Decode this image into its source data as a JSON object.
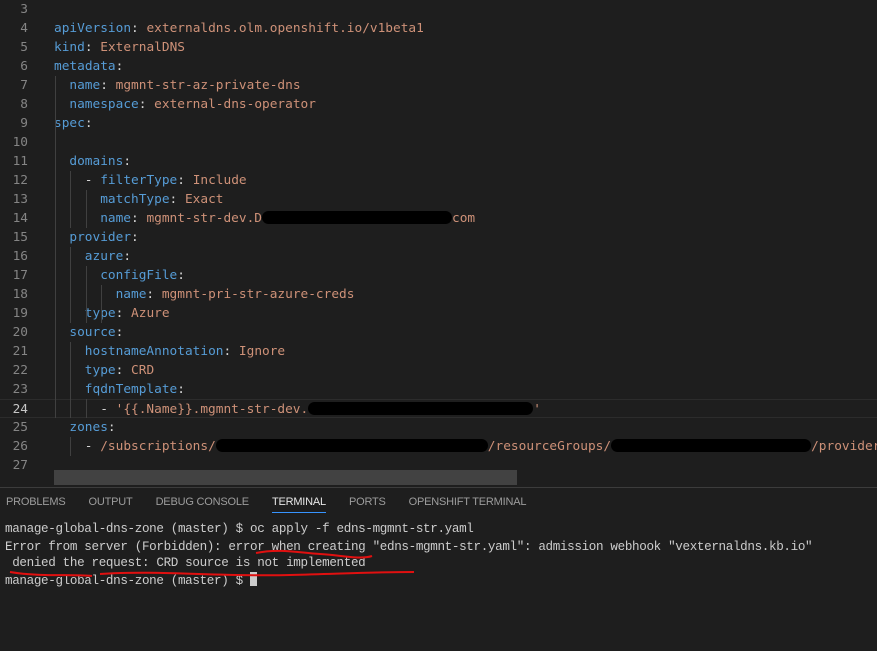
{
  "editor": {
    "current_line": 24,
    "lines": [
      {
        "num": "3",
        "indent": 0,
        "parts": []
      },
      {
        "num": "4",
        "indent": 0,
        "parts": [
          [
            "k",
            "apiVersion"
          ],
          [
            "p",
            ": "
          ],
          [
            "v",
            "externaldns.olm.openshift.io/v1beta1"
          ]
        ]
      },
      {
        "num": "5",
        "indent": 0,
        "parts": [
          [
            "k",
            "kind"
          ],
          [
            "p",
            ": "
          ],
          [
            "v",
            "ExternalDNS"
          ]
        ]
      },
      {
        "num": "6",
        "indent": 0,
        "parts": [
          [
            "k",
            "metadata"
          ],
          [
            "p",
            ":"
          ]
        ]
      },
      {
        "num": "7",
        "indent": 1,
        "parts": [
          [
            "k",
            "name"
          ],
          [
            "p",
            ": "
          ],
          [
            "v",
            "mgmnt-str-az-private-dns"
          ]
        ]
      },
      {
        "num": "8",
        "indent": 1,
        "parts": [
          [
            "k",
            "namespace"
          ],
          [
            "p",
            ": "
          ],
          [
            "v",
            "external-dns-operator"
          ]
        ]
      },
      {
        "num": "9",
        "indent": 0,
        "parts": [
          [
            "k",
            "spec"
          ],
          [
            "p",
            ":"
          ]
        ]
      },
      {
        "num": "10",
        "indent": 0,
        "parts": []
      },
      {
        "num": "11",
        "indent": 1,
        "parts": [
          [
            "k",
            "domains"
          ],
          [
            "p",
            ":"
          ]
        ]
      },
      {
        "num": "12",
        "indent": 2,
        "parts": [
          [
            "p",
            "- "
          ],
          [
            "k",
            "filterType"
          ],
          [
            "p",
            ": "
          ],
          [
            "v",
            "Include"
          ]
        ]
      },
      {
        "num": "13",
        "indent": 3,
        "parts": [
          [
            "k",
            "matchType"
          ],
          [
            "p",
            ": "
          ],
          [
            "v",
            "Exact"
          ]
        ]
      },
      {
        "num": "14",
        "indent": 3,
        "parts": [
          [
            "k",
            "name"
          ],
          [
            "p",
            ": "
          ],
          [
            "v",
            "mgmnt-str-dev.D"
          ],
          [
            "blob",
            "190"
          ],
          [
            "v",
            "com"
          ]
        ]
      },
      {
        "num": "15",
        "indent": 1,
        "parts": [
          [
            "k",
            "provider"
          ],
          [
            "p",
            ":"
          ]
        ]
      },
      {
        "num": "16",
        "indent": 2,
        "parts": [
          [
            "k",
            "azure"
          ],
          [
            "p",
            ":"
          ]
        ]
      },
      {
        "num": "17",
        "indent": 3,
        "parts": [
          [
            "k",
            "configFile"
          ],
          [
            "p",
            ":"
          ]
        ]
      },
      {
        "num": "18",
        "indent": 4,
        "parts": [
          [
            "k",
            "name"
          ],
          [
            "p",
            ": "
          ],
          [
            "v",
            "mgmnt-pri-str-azure-creds"
          ]
        ]
      },
      {
        "num": "19",
        "indent": 2,
        "parts": [
          [
            "k",
            "type"
          ],
          [
            "p",
            ": "
          ],
          [
            "v",
            "Azure"
          ]
        ]
      },
      {
        "num": "20",
        "indent": 1,
        "parts": [
          [
            "k",
            "source"
          ],
          [
            "p",
            ":"
          ]
        ]
      },
      {
        "num": "21",
        "indent": 2,
        "parts": [
          [
            "k",
            "hostnameAnnotation"
          ],
          [
            "p",
            ": "
          ],
          [
            "v",
            "Ignore"
          ]
        ]
      },
      {
        "num": "22",
        "indent": 2,
        "parts": [
          [
            "k",
            "type"
          ],
          [
            "p",
            ": "
          ],
          [
            "v",
            "CRD"
          ]
        ]
      },
      {
        "num": "23",
        "indent": 2,
        "parts": [
          [
            "k",
            "fqdnTemplate"
          ],
          [
            "p",
            ":"
          ]
        ]
      },
      {
        "num": "24",
        "indent": 3,
        "parts": [
          [
            "p",
            "- "
          ],
          [
            "v",
            "'{{.Name}}.mgmnt-str-dev."
          ],
          [
            "blob",
            "225"
          ],
          [
            "v",
            "'"
          ]
        ]
      },
      {
        "num": "25",
        "indent": 1,
        "parts": [
          [
            "k",
            "zones"
          ],
          [
            "p",
            ":"
          ]
        ]
      },
      {
        "num": "26",
        "indent": 2,
        "parts": [
          [
            "p",
            "- "
          ],
          [
            "v",
            "/subscriptions/"
          ],
          [
            "blob",
            "272"
          ],
          [
            "v",
            "/resourceGroups/"
          ],
          [
            "blob",
            "200"
          ],
          [
            "v",
            "/provider"
          ]
        ]
      },
      {
        "num": "27",
        "indent": 0,
        "parts": []
      }
    ]
  },
  "panel": {
    "tabs": [
      "PROBLEMS",
      "OUTPUT",
      "DEBUG CONSOLE",
      "TERMINAL",
      "PORTS",
      "OPENSHIFT TERMINAL"
    ],
    "active_tab": "TERMINAL"
  },
  "terminal": {
    "line1": "manage-global-dns-zone (master) $ oc apply -f edns-mgmnt-str.yaml",
    "line2": "Error from server (Forbidden): error when creating \"edns-mgmnt-str.yaml\": admission webhook \"vexternaldns.kb.io\"",
    "line3": " denied the request: CRD source is not implemented",
    "prompt": "manage-global-dns-zone (master) $ "
  },
  "colors": {
    "annotation": "#e01010",
    "accent": "#3794ff"
  }
}
